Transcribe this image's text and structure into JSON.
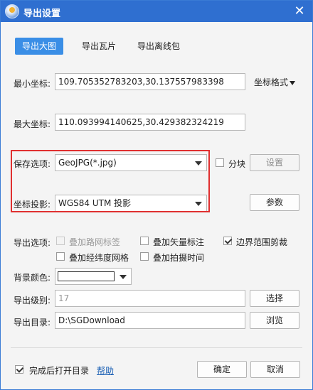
{
  "window": {
    "title": "导出设置"
  },
  "tabs": [
    {
      "label": "导出大图",
      "active": true
    },
    {
      "label": "导出瓦片",
      "active": false
    },
    {
      "label": "导出离线包",
      "active": false
    }
  ],
  "coords": {
    "min_label": "最小坐标:",
    "min_value": "109.705352783203,30.137557983398",
    "max_label": "最大坐标:",
    "max_value": "110.093994140625,30.429382324219",
    "format_menu": "坐标格式"
  },
  "save": {
    "label": "保存选项:",
    "value": "GeoJPG(*.jpg)",
    "tile_label": "分块",
    "tile_checked": false,
    "settings_button": "设置"
  },
  "projection": {
    "label": "坐标投影:",
    "value": "WGS84 UTM 投影",
    "params_button": "参数"
  },
  "options": {
    "label": "导出选项:",
    "items": [
      {
        "label": "叠加路网标签",
        "checked": false,
        "disabled": true
      },
      {
        "label": "叠加矢量标注",
        "checked": false,
        "disabled": false
      },
      {
        "label": "边界范围剪裁",
        "checked": true,
        "disabled": false
      },
      {
        "label": "叠加经纬度网格",
        "checked": false,
        "disabled": false
      },
      {
        "label": "叠加拍摄时间",
        "checked": false,
        "disabled": false
      }
    ]
  },
  "background": {
    "label": "背景颜色:",
    "color": "#ffffff"
  },
  "level": {
    "label": "导出级别:",
    "value": "17",
    "select_button": "选择"
  },
  "directory": {
    "label": "导出目录:",
    "value": "D:\\SGDownload",
    "browse_button": "浏览"
  },
  "footer": {
    "open_after_label": "完成后打开目录",
    "open_after_checked": true,
    "help_link": "帮助",
    "ok_button": "确定",
    "cancel_button": "取消"
  },
  "colors": {
    "titlebar": "#2f6fd0",
    "active_tab": "#3a8ee6",
    "highlight": "#e03030"
  }
}
